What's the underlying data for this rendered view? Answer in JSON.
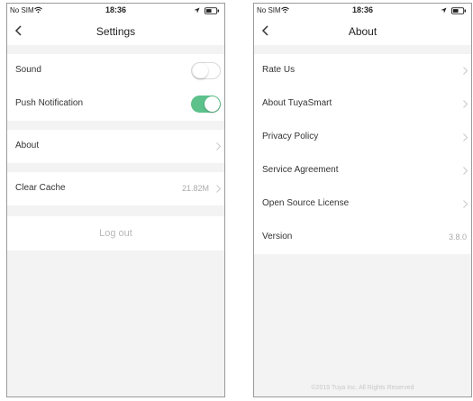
{
  "status_bar": {
    "carrier": "No SIM",
    "time": "18:36"
  },
  "settings": {
    "title": "Settings",
    "sound_label": "Sound",
    "sound_on": false,
    "push_label": "Push Notification",
    "push_on": true,
    "about_label": "About",
    "clear_cache_label": "Clear Cache",
    "cache_size": "21.82M",
    "logout_label": "Log out",
    "toggle_on_color": "#5cc18a"
  },
  "about": {
    "title": "About",
    "items": [
      {
        "label": "Rate Us"
      },
      {
        "label": "About TuyaSmart"
      },
      {
        "label": "Privacy Policy"
      },
      {
        "label": "Service Agreement"
      },
      {
        "label": "Open Source License"
      }
    ],
    "version_label": "Version",
    "version_value": "3.8.0",
    "copyright": "©2019 Tuya Inc. All Rights Reserved"
  }
}
